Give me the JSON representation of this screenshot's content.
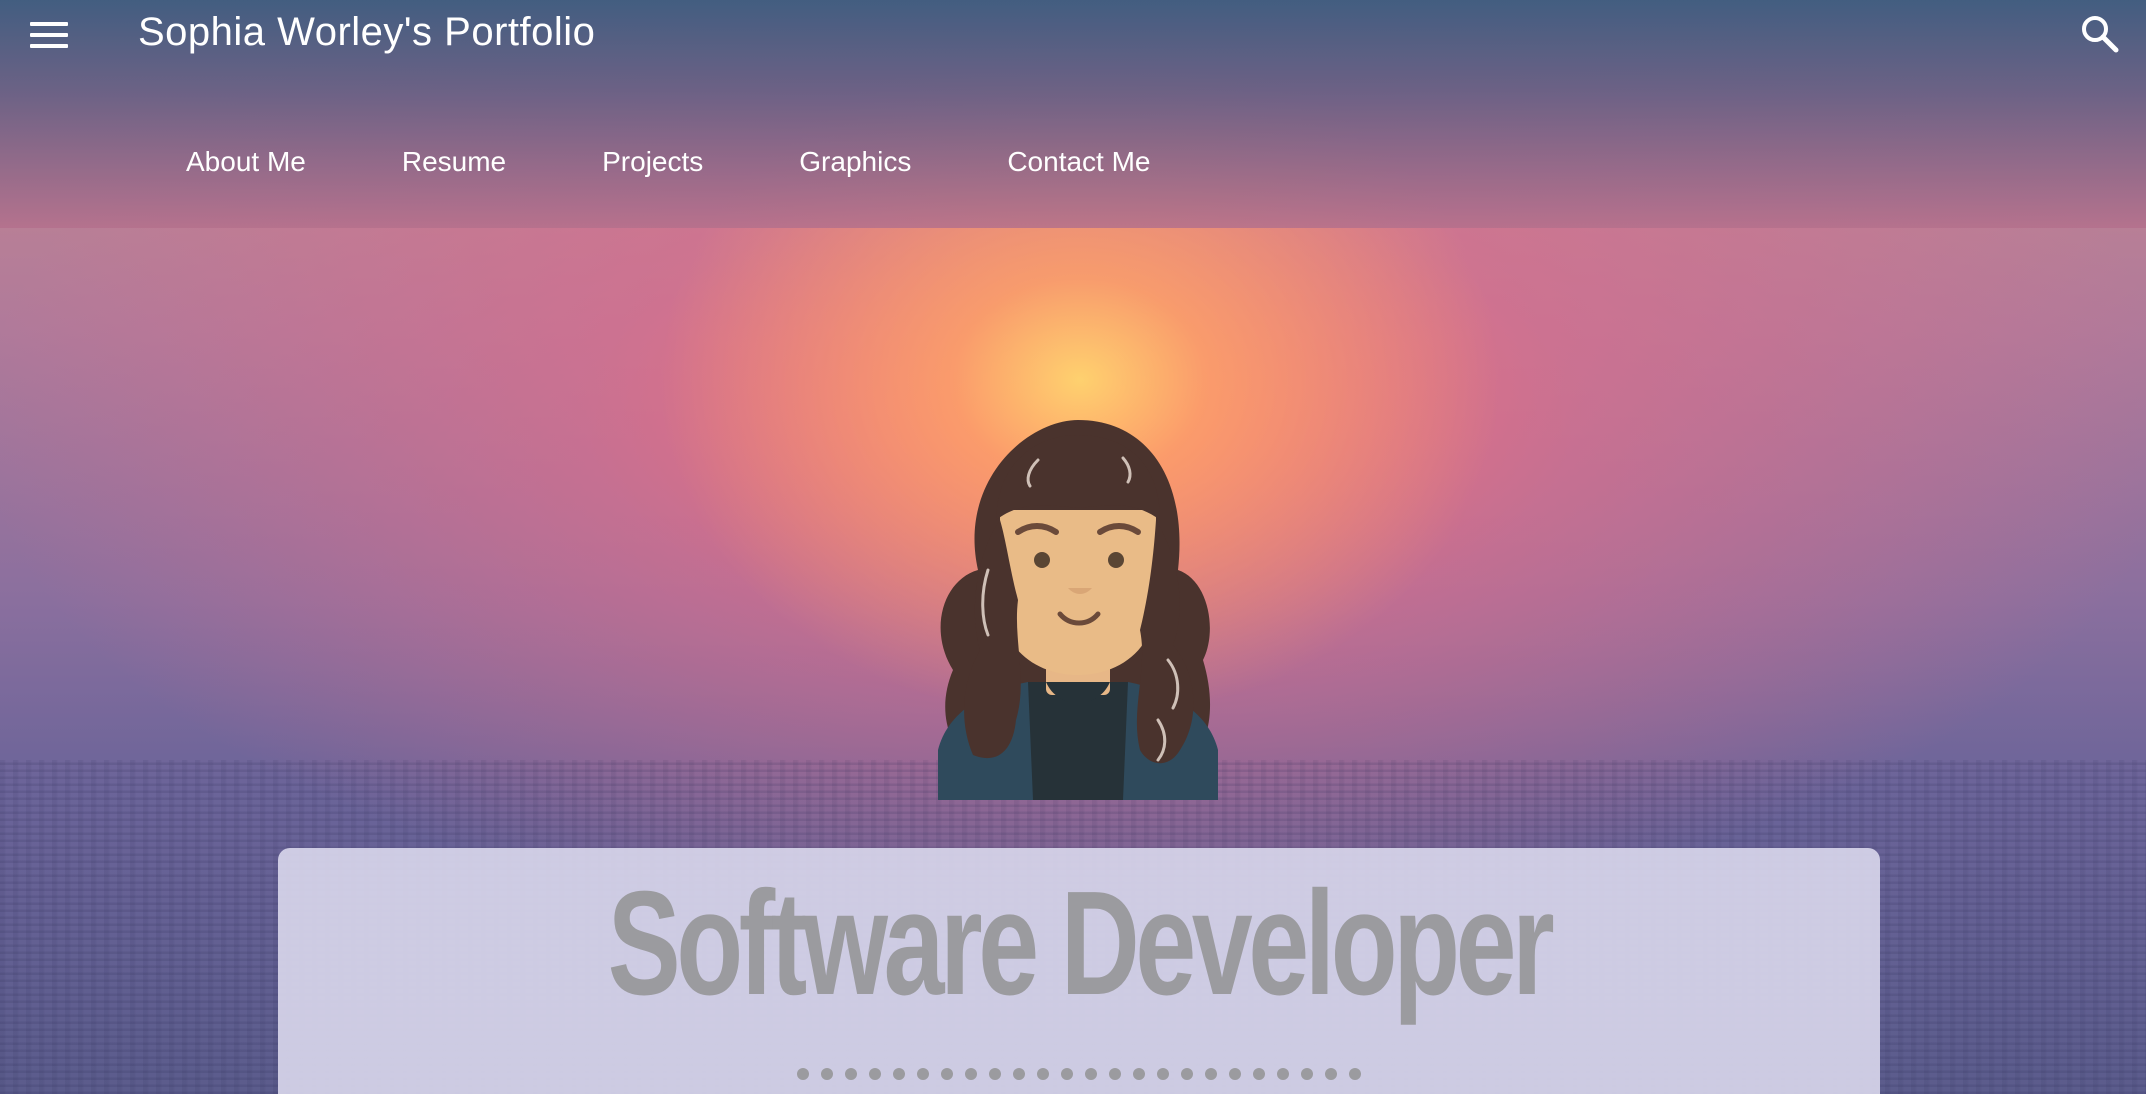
{
  "header": {
    "title": "Sophia Worley's Portfolio",
    "menu_icon": "hamburger-menu-icon",
    "search_icon": "search-icon"
  },
  "nav": {
    "tabs": [
      {
        "label": "About Me"
      },
      {
        "label": "Resume"
      },
      {
        "label": "Projects"
      },
      {
        "label": "Graphics"
      },
      {
        "label": "Contact Me"
      }
    ]
  },
  "hero": {
    "avatar_icon": "avatar-illustration",
    "card_title": "Software Developer"
  },
  "colors": {
    "appbar_top": "#3e5c80",
    "appbar_bottom": "#b4708c",
    "card_background": "#d6d4ea",
    "card_text": "#9b9b9f",
    "nav_text": "#ffffff"
  }
}
